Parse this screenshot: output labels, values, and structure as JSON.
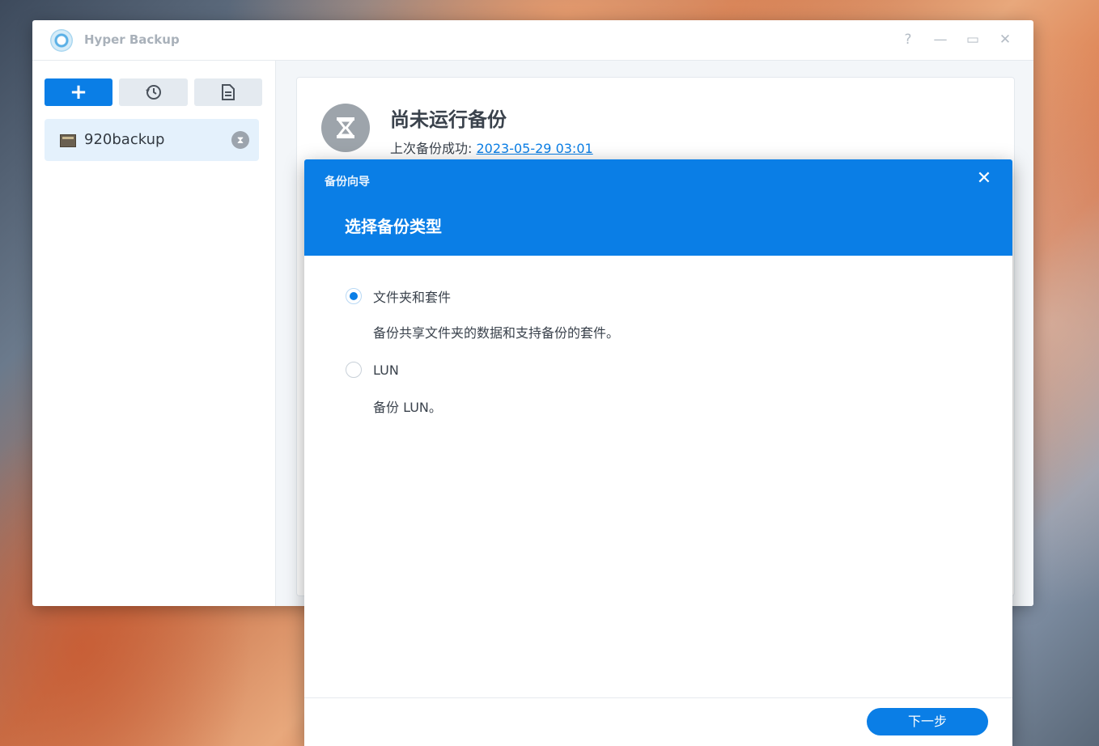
{
  "app": {
    "title": "Hyper Backup"
  },
  "window_controls": {
    "help": "?",
    "minimize": "—",
    "maximize": "▭",
    "close": "✕"
  },
  "sidebar": {
    "add_label": "+",
    "tasks": [
      {
        "label": "920backup"
      }
    ]
  },
  "status": {
    "title": "尚未运行备份",
    "last_success_label": "上次备份成功:",
    "last_success_time": "2023-05-29 03:01"
  },
  "wizard": {
    "header_small": "备份向导",
    "close": "✕",
    "title": "选择备份类型",
    "options": [
      {
        "label": "文件夹和套件",
        "description": "备份共享文件夹的数据和支持备份的套件。",
        "selected": true
      },
      {
        "label": "LUN",
        "description": "备份 LUN。",
        "selected": false
      }
    ],
    "next_label": "下一步"
  },
  "colors": {
    "accent": "#0a7ee6"
  }
}
